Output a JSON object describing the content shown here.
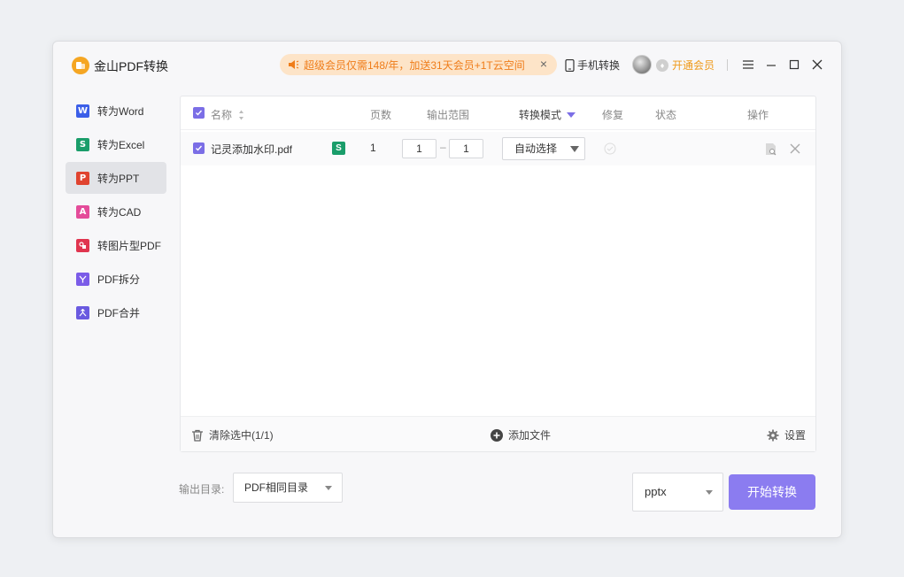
{
  "app": {
    "title": "金山PDF转换"
  },
  "promo": {
    "text": "超级会员仅需148/年，加送31天会员+1T云空间"
  },
  "header": {
    "phone_label": "手机转换",
    "vip_label": "开通会员"
  },
  "sidebar": {
    "items": [
      {
        "label": "转为Word",
        "icon_letter": "W",
        "color": "#3b5ee8",
        "active": false
      },
      {
        "label": "转为Excel",
        "icon_letter": "S",
        "color": "#1a9d6a",
        "active": false
      },
      {
        "label": "转为PPT",
        "icon_letter": "P",
        "color": "#e0432f",
        "active": true
      },
      {
        "label": "转为CAD",
        "icon_letter": "A",
        "color": "#e44c9a",
        "active": false
      },
      {
        "label": "转图片型PDF",
        "icon_letter": "",
        "color": "#e0354f",
        "active": false
      },
      {
        "label": "PDF拆分",
        "icon_letter": "",
        "color": "#7b5ce8",
        "active": false
      },
      {
        "label": "PDF合并",
        "icon_letter": "",
        "color": "#6a5ae0",
        "active": false
      }
    ]
  },
  "table": {
    "headers": {
      "name": "名称",
      "pages": "页数",
      "range": "输出范围",
      "mode": "转换模式",
      "repair": "修复",
      "status": "状态",
      "action": "操作"
    },
    "rows": [
      {
        "name": "记灵添加水印.pdf",
        "badge": "S",
        "pages": "1",
        "range_from": "1",
        "range_to": "1",
        "range_sep": "–",
        "mode": "自动选择"
      }
    ]
  },
  "footer": {
    "clear_label": "清除选中(1/1)",
    "add_label": "添加文件",
    "settings_label": "设置"
  },
  "bottom": {
    "output_label": "输出目录:",
    "output_value": "PDF相同目录",
    "format_value": "pptx",
    "start_label": "开始转换"
  },
  "colors": {
    "accent": "#8b7cf0",
    "checkbox": "#7b6ee6",
    "promo_text": "#ef7d1a",
    "promo_bg": "#fde4c8"
  }
}
